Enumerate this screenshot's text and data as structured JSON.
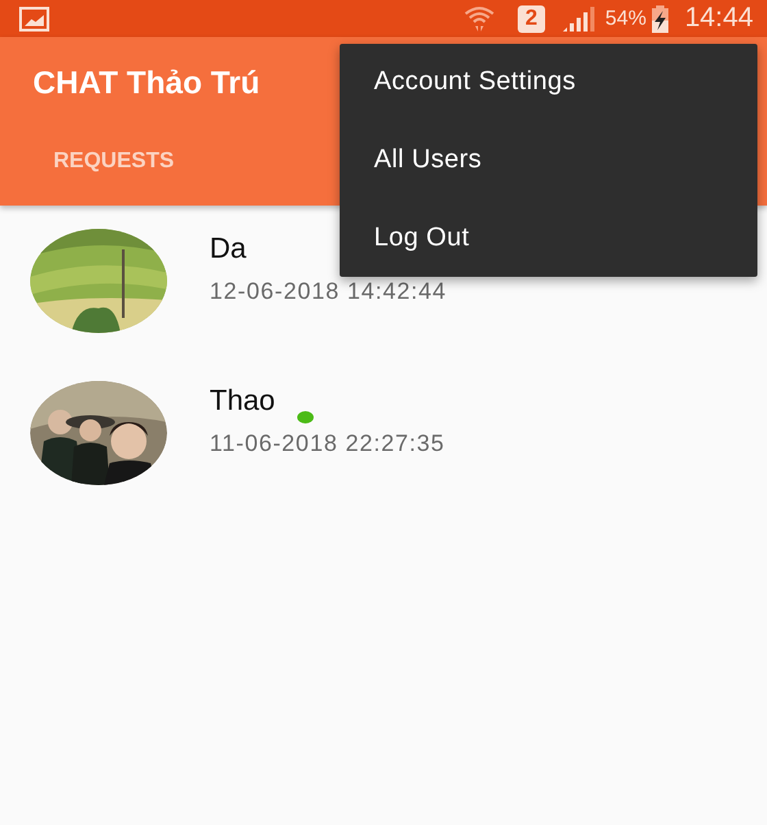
{
  "status_bar": {
    "sim_slot": "2",
    "battery": "54%",
    "time": "14:44"
  },
  "app_bar": {
    "title": "CHAT Thảo Trú"
  },
  "tabs": [
    {
      "label": "REQUESTS",
      "selected": false
    }
  ],
  "menu": {
    "items": [
      {
        "label": "Account Settings"
      },
      {
        "label": "All Users"
      },
      {
        "label": "Log Out"
      }
    ]
  },
  "users": [
    {
      "name": "Da",
      "time": "12-06-2018 14:42:44",
      "online": false
    },
    {
      "name": "Thao",
      "time": "11-06-2018 22:27:35",
      "online": true
    }
  ]
}
